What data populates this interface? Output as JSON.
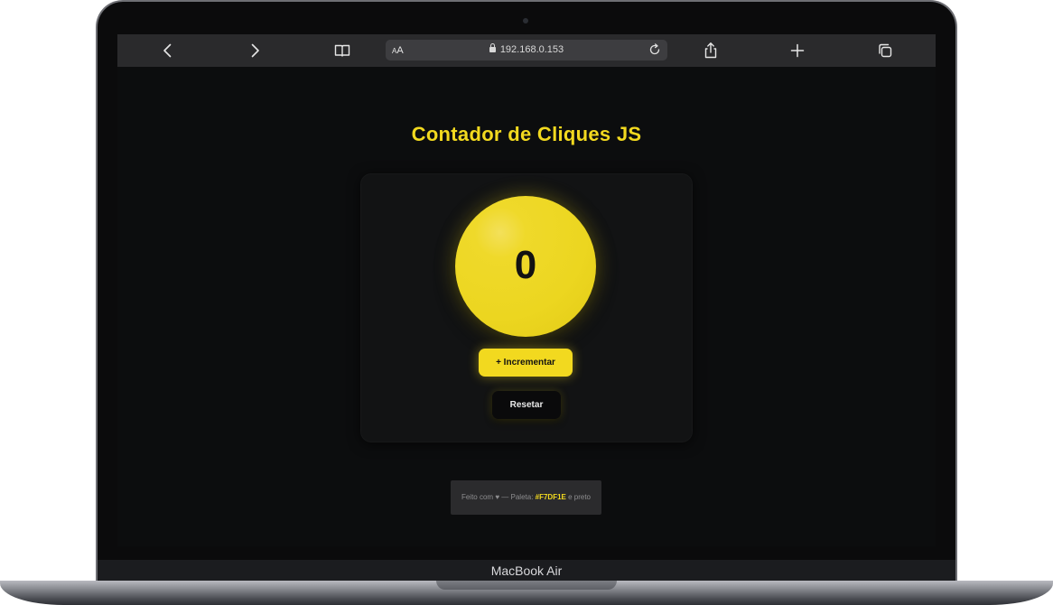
{
  "browser": {
    "address_aa_small": "A",
    "address_aa_large": "A",
    "url": "192.168.0.153",
    "icons": [
      "back-icon",
      "forward-icon",
      "bookmarks-icon",
      "reload-icon",
      "share-icon",
      "new-tab-icon",
      "tabs-icon"
    ]
  },
  "app": {
    "title": "Contador de Cliques JS",
    "counter_value": "0",
    "increment_label": "+ Incrementar",
    "reset_label": "Resetar"
  },
  "footer": {
    "prefix": "Feito com ♥ — Paleta: ",
    "hex": "#F7DF1E",
    "suffix": " e preto"
  },
  "device": {
    "label": "MacBook Air"
  },
  "colors": {
    "accent": "#F2D91F",
    "background": "#0C0D0E",
    "card": "#121314"
  }
}
